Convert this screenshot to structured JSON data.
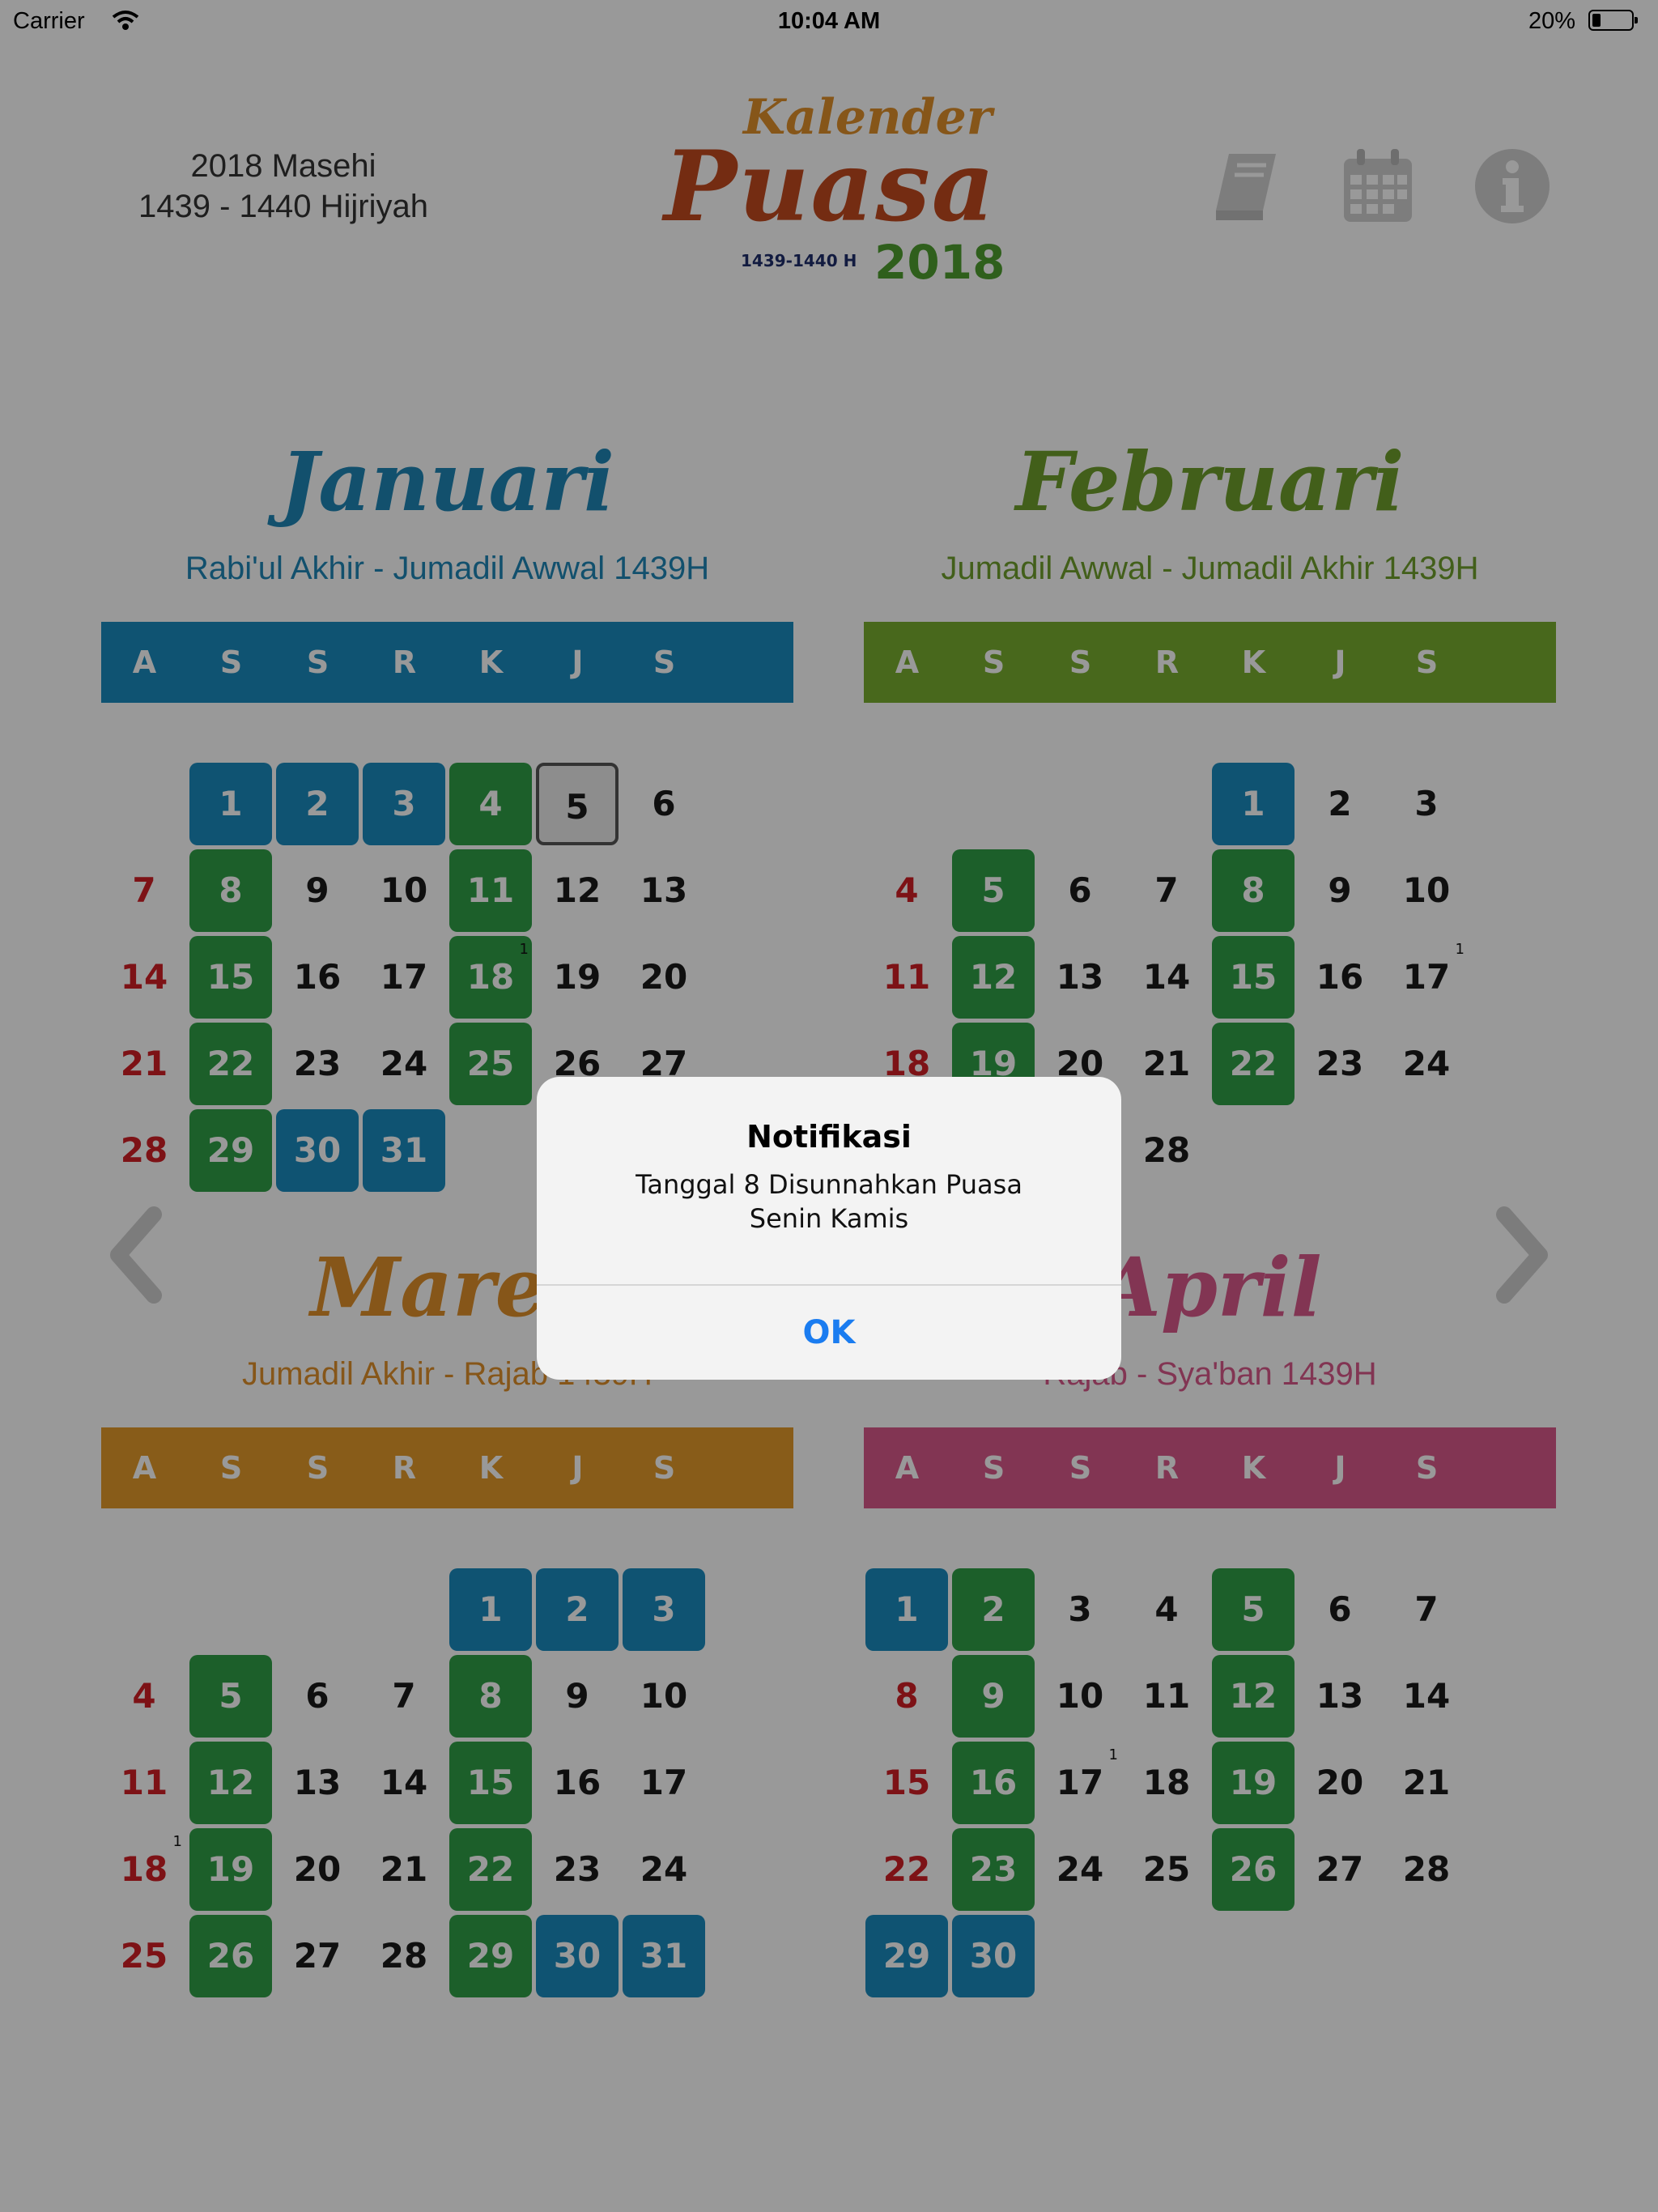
{
  "status_bar": {
    "carrier": "Carrier",
    "time": "10:04 AM",
    "battery": "20%"
  },
  "header": {
    "year_masehi": "2018 Masehi",
    "year_hijriyah": "1439 - 1440 Hijriyah",
    "logo": {
      "line1": "Kalender",
      "line2": "Puasa",
      "hijri": "1439-1440 H",
      "year": "2018"
    },
    "icons": [
      "book-icon",
      "calendar-icon",
      "info-icon"
    ]
  },
  "weekdays": [
    "A",
    "S",
    "S",
    "R",
    "K",
    "J",
    "S"
  ],
  "colors": {
    "fasting_monday_thursday": "#2f9e47",
    "fasting_ayyamul_bidh": "#1a8bbf",
    "sunday_text": "#d01f25"
  },
  "months": [
    {
      "name": "Januari",
      "hijri": "Rabi'ul Akhir - Jumadil Awwal 1439H",
      "color": "#1a8bbf",
      "title_color": "#1e86b6",
      "start": 1,
      "days": 31,
      "green": [
        4,
        8,
        11,
        15,
        18,
        22,
        25,
        29
      ],
      "blue": [
        1,
        2,
        3,
        30,
        31
      ],
      "today": 5,
      "marked": {
        "18": "1"
      }
    },
    {
      "name": "Februari",
      "hijri": "Jumadil Awwal - Jumadil Akhir 1439H",
      "color": "#78ad2f",
      "title_color": "#6f9e2c",
      "start": 4,
      "days": 28,
      "green": [
        5,
        8,
        12,
        15,
        19,
        22
      ],
      "blue": [
        1
      ],
      "today": null,
      "marked": {
        "17": "1"
      }
    },
    {
      "name": "Maret",
      "hijri": "Jumadil Akhir - Rajab 1439H",
      "color": "#e39a2b",
      "title_color": "#e0902a",
      "start": 4,
      "days": 31,
      "green": [
        5,
        8,
        12,
        15,
        19,
        22,
        26,
        29
      ],
      "blue": [
        1,
        2,
        3,
        30,
        31
      ],
      "today": null,
      "marked": {
        "18": "1"
      }
    },
    {
      "name": "April",
      "hijri": "Rajab - Sya'ban 1439H",
      "color": "#d9598a",
      "title_color": "#d9598a",
      "start": 0,
      "days": 30,
      "green": [
        2,
        5,
        9,
        12,
        16,
        19,
        23,
        26
      ],
      "blue": [
        1,
        29,
        30
      ],
      "today": null,
      "marked": {
        "17": "1"
      }
    }
  ],
  "dialog": {
    "title": "Notifikasi",
    "message_line1": "Tanggal 8 Disunnahkan Puasa",
    "message_line2": "Senin Kamis",
    "ok_label": "OK"
  }
}
